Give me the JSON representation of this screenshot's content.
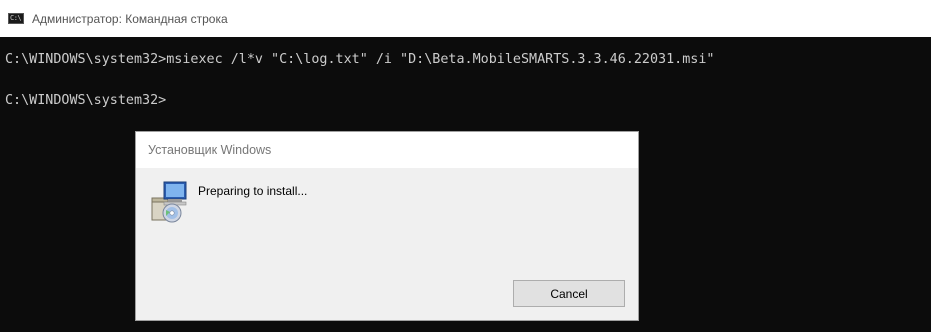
{
  "window": {
    "title": "Администратор: Командная строка",
    "icon": "cmd-icon",
    "icon_label": "C:\\"
  },
  "console": {
    "lines": [
      "C:\\WINDOWS\\system32>msiexec /l*v \"C:\\log.txt\" /i \"D:\\Beta.MobileSMARTS.3.3.46.22031.msi\"",
      "C:\\WINDOWS\\system32>"
    ],
    "text_color": "#cccccc",
    "background_color": "#0c0c0c"
  },
  "dialog": {
    "title": "Установщик Windows",
    "icon": "windows-installer-icon",
    "message": "Preparing to install...",
    "cancel_label": "Cancel"
  }
}
